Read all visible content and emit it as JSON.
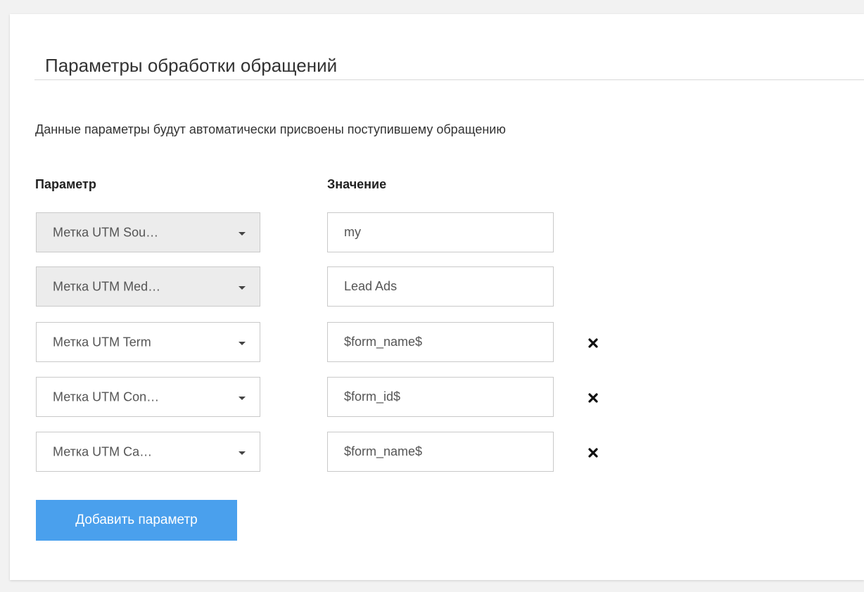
{
  "panel": {
    "title": "Параметры обработки обращений",
    "description": "Данные параметры будут автоматически присвоены поступившему обращению"
  },
  "columns": {
    "parameter": "Параметр",
    "value": "Значение"
  },
  "rows": [
    {
      "parameter": "Метка UTM Sou…",
      "value": "my",
      "disabled": true,
      "removable": false
    },
    {
      "parameter": "Метка UTM Med…",
      "value": "Lead Ads",
      "disabled": true,
      "removable": false
    },
    {
      "parameter": "Метка UTM Term",
      "value": "$form_name$",
      "disabled": false,
      "removable": true
    },
    {
      "parameter": "Метка UTM Con…",
      "value": "$form_id$",
      "disabled": false,
      "removable": true
    },
    {
      "parameter": "Метка UTM Ca…",
      "value": "$form_name$",
      "disabled": false,
      "removable": true
    }
  ],
  "icons": {
    "dropdown": "chevron-down-icon",
    "remove": "close-icon"
  },
  "add_button_label": "Добавить параметр",
  "colors": {
    "accent": "#4aa0ed",
    "disabled_select_bg": "#ececec"
  }
}
